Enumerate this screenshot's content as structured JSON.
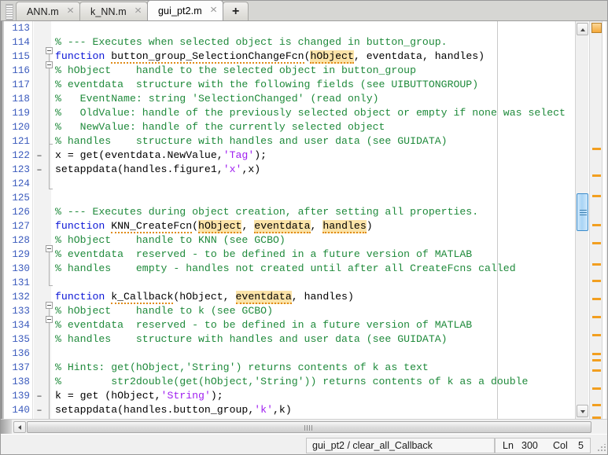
{
  "tabs": [
    {
      "label": "ANN.m",
      "active": false,
      "close": "✕"
    },
    {
      "label": "k_NN.m",
      "active": false,
      "close": "✕"
    },
    {
      "label": "gui_pt2.m",
      "active": true,
      "close": "✕"
    },
    {
      "label": "+",
      "newtab": true
    }
  ],
  "editor": {
    "first_line": 113,
    "lines": [
      {
        "n": 113,
        "dash": "",
        "text": ""
      },
      {
        "n": 114,
        "dash": "",
        "text": "% --- Executes when selected object is changed in button_group."
      },
      {
        "n": 115,
        "dash": "",
        "text": "function button_group_SelectionChangeFcn(hObject, eventdata, handles)"
      },
      {
        "n": 116,
        "dash": "",
        "text": "% hObject    handle to the selected object in button_group"
      },
      {
        "n": 117,
        "dash": "",
        "text": "% eventdata  structure with the following fields (see UIBUTTONGROUP)"
      },
      {
        "n": 118,
        "dash": "",
        "text": "%   EventName: string 'SelectionChanged' (read only)"
      },
      {
        "n": 119,
        "dash": "",
        "text": "%   OldValue: handle of the previously selected object or empty if none was select"
      },
      {
        "n": 120,
        "dash": "",
        "text": "%   NewValue: handle of the currently selected object"
      },
      {
        "n": 121,
        "dash": "",
        "text": "% handles    structure with handles and user data (see GUIDATA)"
      },
      {
        "n": 122,
        "dash": "–",
        "text": "x = get(eventdata.NewValue,'Tag');"
      },
      {
        "n": 123,
        "dash": "–",
        "text": "setappdata(handles.figure1,'x',x)"
      },
      {
        "n": 124,
        "dash": "",
        "text": ""
      },
      {
        "n": 125,
        "dash": "",
        "text": ""
      },
      {
        "n": 126,
        "dash": "",
        "text": "% --- Executes during object creation, after setting all properties."
      },
      {
        "n": 127,
        "dash": "",
        "text": "function KNN_CreateFcn(hObject, eventdata, handles)"
      },
      {
        "n": 128,
        "dash": "",
        "text": "% hObject    handle to KNN (see GCBO)"
      },
      {
        "n": 129,
        "dash": "",
        "text": "% eventdata  reserved - to be defined in a future version of MATLAB"
      },
      {
        "n": 130,
        "dash": "",
        "text": "% handles    empty - handles not created until after all CreateFcns called"
      },
      {
        "n": 131,
        "dash": "",
        "text": ""
      },
      {
        "n": 132,
        "dash": "",
        "text": "function k_Callback(hObject, eventdata, handles)"
      },
      {
        "n": 133,
        "dash": "",
        "text": "% hObject    handle to k (see GCBO)"
      },
      {
        "n": 134,
        "dash": "",
        "text": "% eventdata  reserved - to be defined in a future version of MATLAB"
      },
      {
        "n": 135,
        "dash": "",
        "text": "% handles    structure with handles and user data (see GUIDATA)"
      },
      {
        "n": 136,
        "dash": "",
        "text": ""
      },
      {
        "n": 137,
        "dash": "",
        "text": "% Hints: get(hObject,'String') returns contents of k as text"
      },
      {
        "n": 138,
        "dash": "",
        "text": "%        str2double(get(hObject,'String')) returns contents of k as a double"
      },
      {
        "n": 139,
        "dash": "–",
        "text": "k = get (hObject,'String');"
      },
      {
        "n": 140,
        "dash": "–",
        "text": "setappdata(handles.button_group,'k',k)"
      }
    ],
    "highlighted_tokens": [
      "hObject",
      "eventdata",
      "handles"
    ],
    "colors": {
      "comment": "#1f8a3b",
      "keyword": "#0b16d6",
      "string": "#a020f0",
      "highlight": "#fbe3a8",
      "marker": "#f29f20",
      "linenumber": "#3b5bbd"
    }
  },
  "scrollbars": {
    "vertical": {
      "up_arrow": "▲",
      "down_arrow": "▼",
      "thumb_position_pct": 43
    },
    "horizontal": {
      "left_arrow": "◀",
      "thumb_width_pct": 95
    }
  },
  "marker_strip": {
    "top_marker": "warning-summary",
    "marker_count": 16
  },
  "statusbar": {
    "function_path": "gui_pt2 / clear_all_Callback",
    "ln_label": "Ln",
    "ln_value": "300",
    "col_label": "Col",
    "col_value": "5"
  }
}
